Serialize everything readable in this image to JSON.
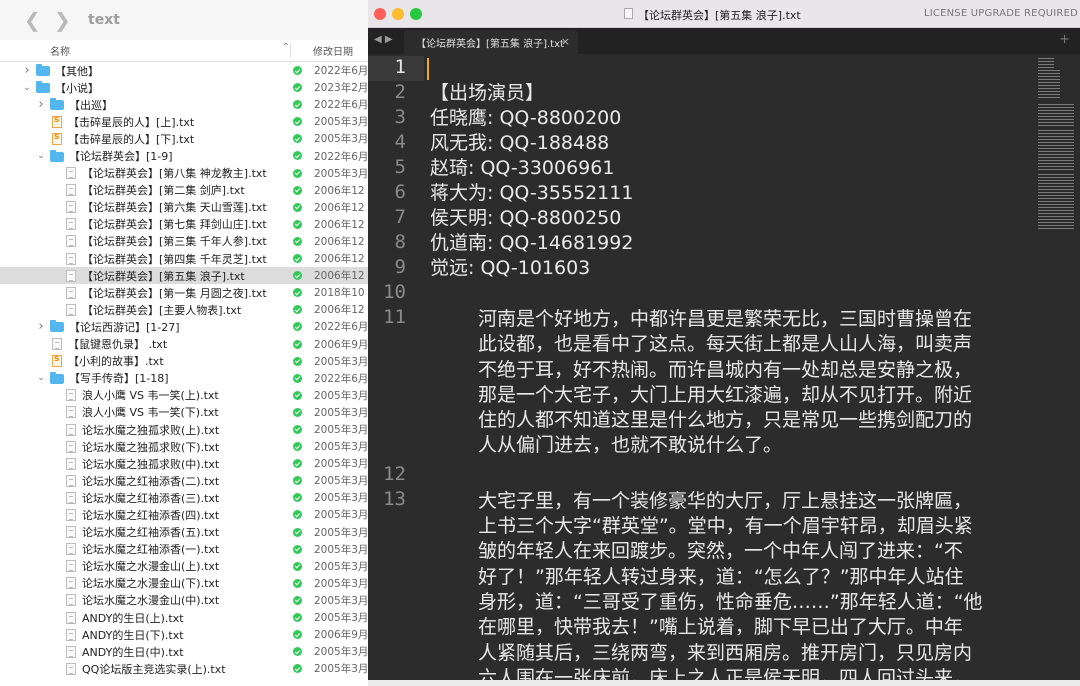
{
  "finder": {
    "title": "text",
    "columns": {
      "name": "名称",
      "date": "修改日期"
    },
    "rows": [
      {
        "name": "【其他】",
        "date": "2022年6月",
        "kind": "folder",
        "depth": 0,
        "open": false
      },
      {
        "name": "【小说】",
        "date": "2023年2月",
        "kind": "folder",
        "depth": 0,
        "open": true
      },
      {
        "name": "【出巡】",
        "date": "2022年6月",
        "kind": "folder",
        "depth": 1,
        "open": false
      },
      {
        "name": "【击碎星辰的人】[上].txt",
        "date": "2005年3月",
        "kind": "sublime",
        "depth": 1
      },
      {
        "name": "【击碎星辰的人】[下].txt",
        "date": "2005年3月",
        "kind": "sublime",
        "depth": 1
      },
      {
        "name": "【论坛群英会】[1-9]",
        "date": "2022年6月",
        "kind": "folder",
        "depth": 1,
        "open": true
      },
      {
        "name": "【论坛群英会】[第八集 神龙教主].txt",
        "date": "2005年3月",
        "kind": "doc",
        "depth": 2
      },
      {
        "name": "【论坛群英会】[第二集 剑庐].txt",
        "date": "2006年12",
        "kind": "doc",
        "depth": 2
      },
      {
        "name": "【论坛群英会】[第六集 天山雪莲].txt",
        "date": "2006年12",
        "kind": "doc",
        "depth": 2
      },
      {
        "name": "【论坛群英会】[第七集 拜剑山庄].txt",
        "date": "2006年12",
        "kind": "doc",
        "depth": 2
      },
      {
        "name": "【论坛群英会】[第三集 千年人参].txt",
        "date": "2006年12",
        "kind": "doc",
        "depth": 2
      },
      {
        "name": "【论坛群英会】[第四集 千年灵芝].txt",
        "date": "2006年12",
        "kind": "doc",
        "depth": 2
      },
      {
        "name": "【论坛群英会】[第五集 浪子].txt",
        "date": "2006年12",
        "kind": "doc",
        "depth": 2,
        "selected": true
      },
      {
        "name": "【论坛群英会】[第一集 月圆之夜].txt",
        "date": "2018年10",
        "kind": "doc",
        "depth": 2
      },
      {
        "name": "【论坛群英会】[主要人物表].txt",
        "date": "2006年12",
        "kind": "doc",
        "depth": 2
      },
      {
        "name": "【论坛西游记】[1-27]",
        "date": "2022年6月",
        "kind": "folder",
        "depth": 1,
        "open": false
      },
      {
        "name": "【鼠键恩仇录】 .txt",
        "date": "2006年9月",
        "kind": "doc",
        "depth": 1
      },
      {
        "name": "【小利的故事】.txt",
        "date": "2005年3月",
        "kind": "sublime",
        "depth": 1
      },
      {
        "name": "【写手传奇】[1-18]",
        "date": "2022年6月",
        "kind": "folder",
        "depth": 1,
        "open": true
      },
      {
        "name": "浪人小鹰 VS 韦一笑(上).txt",
        "date": "2005年3月",
        "kind": "doc",
        "depth": 2
      },
      {
        "name": "浪人小鹰 VS 韦一笑(下).txt",
        "date": "2005年3月",
        "kind": "doc",
        "depth": 2
      },
      {
        "name": "论坛水魔之独孤求败(上).txt",
        "date": "2005年3月",
        "kind": "doc",
        "depth": 2
      },
      {
        "name": "论坛水魔之独孤求败(下).txt",
        "date": "2005年3月",
        "kind": "doc",
        "depth": 2
      },
      {
        "name": "论坛水魔之独孤求败(中).txt",
        "date": "2005年3月",
        "kind": "doc",
        "depth": 2
      },
      {
        "name": "论坛水魔之红袖添香(二).txt",
        "date": "2005年3月",
        "kind": "doc",
        "depth": 2
      },
      {
        "name": "论坛水魔之红袖添香(三).txt",
        "date": "2005年3月",
        "kind": "doc",
        "depth": 2
      },
      {
        "name": "论坛水魔之红袖添香(四).txt",
        "date": "2005年3月",
        "kind": "doc",
        "depth": 2
      },
      {
        "name": "论坛水魔之红袖添香(五).txt",
        "date": "2005年3月",
        "kind": "doc",
        "depth": 2
      },
      {
        "name": "论坛水魔之红袖添香(一).txt",
        "date": "2005年3月",
        "kind": "doc",
        "depth": 2
      },
      {
        "name": "论坛水魔之水漫金山(上).txt",
        "date": "2005年3月",
        "kind": "doc",
        "depth": 2
      },
      {
        "name": "论坛水魔之水漫金山(下).txt",
        "date": "2005年3月",
        "kind": "doc",
        "depth": 2
      },
      {
        "name": "论坛水魔之水漫金山(中).txt",
        "date": "2005年3月",
        "kind": "doc",
        "depth": 2
      },
      {
        "name": "ANDY的生日(上).txt",
        "date": "2005年3月",
        "kind": "doc",
        "depth": 2
      },
      {
        "name": "ANDY的生日(下).txt",
        "date": "2006年9月",
        "kind": "doc",
        "depth": 2
      },
      {
        "name": "ANDY的生日(中).txt",
        "date": "2005年3月",
        "kind": "doc",
        "depth": 2
      },
      {
        "name": "QQ论坛版主竞选实录(上).txt",
        "date": "2005年3月",
        "kind": "doc",
        "depth": 2
      }
    ]
  },
  "editor": {
    "window_title": "【论坛群英会】[第五集 浪子].txt",
    "license": "LICENSE UPGRADE REQUIRED",
    "tab_label": "【论坛群英会】[第五集 浪子].txt",
    "tab_close": "×",
    "tab_add": "+",
    "nav_arrows": "◀ ▶",
    "lines": [
      {
        "num": "1",
        "text": ""
      },
      {
        "num": "2",
        "text": "【出场演员】"
      },
      {
        "num": "3",
        "text": "任晓鹰: QQ-8800200"
      },
      {
        "num": "4",
        "text": "风无我: QQ-188488"
      },
      {
        "num": "5",
        "text": "赵琦: QQ-33006961"
      },
      {
        "num": "6",
        "text": "蒋大为: QQ-35552111"
      },
      {
        "num": "7",
        "text": "侯天明: QQ-8800250"
      },
      {
        "num": "8",
        "text": "仇道南: QQ-14681992"
      },
      {
        "num": "9",
        "text": "觉远: QQ-101603"
      },
      {
        "num": "10",
        "text": ""
      }
    ],
    "para11": {
      "num": "11",
      "lines": [
        "河南是个好地方，中都许昌更是繁荣无比，三国时曹操曾在",
        "此设都，也是看中了这点。每天街上都是人山人海，叫卖声",
        "不绝于耳，好不热闹。而许昌城内有一处却总是安静之极，",
        "那是一个大宅子，大门上用大红漆遍，却从不见打开。附近",
        "住的人都不知道这里是什么地方，只是常见一些携剑配刀的",
        "人从偏门进去，也就不敢说什么了。"
      ]
    },
    "line12": {
      "num": "12"
    },
    "para13": {
      "num": "13",
      "lines": [
        "大宅子里，有一个装修豪华的大厅，厅上悬挂这一张牌匾，",
        "上书三个大字“群英堂”。堂中，有一个眉宇轩昂，却眉头紧",
        "皱的年轻人在来回踱步。突然，一个中年人闯了进来：“不",
        "好了！”那年轻人转过身来，道：“怎么了？”那中年人站住",
        "身形，道：“三哥受了重伤，性命垂危……”那年轻人道：“他",
        "在哪里，快带我去！”嘴上说着，脚下早已出了大厅。中年",
        "人紧随其后，三绕两弯，来到西厢房。推开房门，只见房内",
        "六人围在一张床前，床上之人正是侯天明，四人回过头来，"
      ]
    }
  }
}
